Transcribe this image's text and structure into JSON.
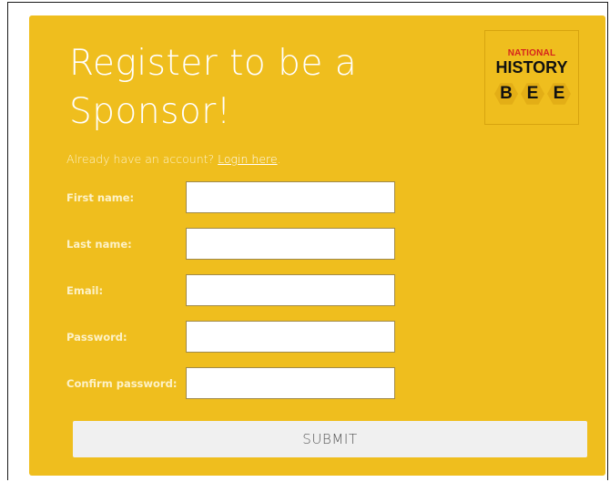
{
  "form": {
    "title": "Register to be a Sponsor!",
    "login_prompt": "Already have an account? ",
    "login_link": "Login here",
    "login_suffix": ".",
    "fields": [
      {
        "label": "First name:",
        "value": "",
        "placeholder": ""
      },
      {
        "label": "Last name:",
        "value": "",
        "placeholder": ""
      },
      {
        "label": "Email:",
        "value": "",
        "placeholder": ""
      },
      {
        "label": "Password:",
        "value": "",
        "placeholder": ""
      },
      {
        "label": "Confirm password:",
        "value": "",
        "placeholder": ""
      }
    ],
    "submit_label": "SUBMIT"
  },
  "logo": {
    "line1": "NATIONAL",
    "line2": "HISTORY",
    "letters": [
      "B",
      "E",
      "E"
    ]
  },
  "colors": {
    "panel_background": "#efbe1e",
    "logo_accent_red": "#d6241c",
    "button_background": "#f0f0f0"
  }
}
